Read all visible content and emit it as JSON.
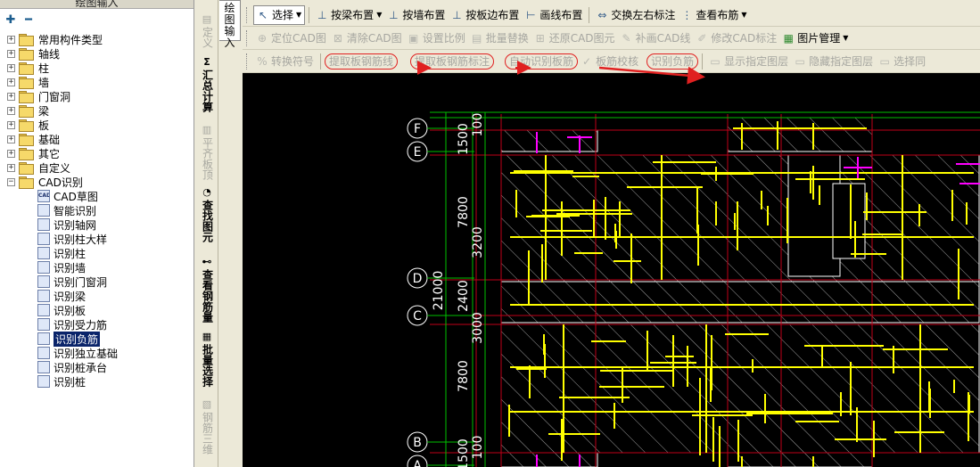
{
  "panel_title": "绘图输入",
  "tree": [
    {
      "label": "常用构件类型",
      "expanded": false
    },
    {
      "label": "轴线",
      "expanded": false
    },
    {
      "label": "柱",
      "expanded": false
    },
    {
      "label": "墙",
      "expanded": false
    },
    {
      "label": "门窗洞",
      "expanded": false
    },
    {
      "label": "梁",
      "expanded": false
    },
    {
      "label": "板",
      "expanded": false
    },
    {
      "label": "基础",
      "expanded": false
    },
    {
      "label": "其它",
      "expanded": false
    },
    {
      "label": "自定义",
      "expanded": false
    },
    {
      "label": "CAD识别",
      "expanded": true
    }
  ],
  "cad_children": [
    "CAD草图",
    "智能识别",
    "识别轴网",
    "识别柱大样",
    "识别柱",
    "识别墙",
    "识别门窗洞",
    "识别梁",
    "识别板",
    "识别受力筋",
    "识别负筋",
    "识别独立基础",
    "识别桩承台",
    "识别桩"
  ],
  "cad_icons": [
    "CAD",
    "",
    "",
    "",
    "",
    "",
    "",
    "",
    "",
    "",
    "",
    "",
    "",
    ""
  ],
  "selected_child": "识别负筋",
  "vtabs": [
    {
      "label": "定义",
      "dim": true
    },
    {
      "label": "汇总计算",
      "dim": false
    },
    {
      "label": "平齐板顶",
      "dim": true
    },
    {
      "label": "查找图元",
      "dim": false
    },
    {
      "label": "查看钢筋量",
      "dim": false
    },
    {
      "label": "批量选择",
      "dim": false
    },
    {
      "label": "钢筋三维",
      "dim": true
    }
  ],
  "vtab_active_label": "绘图输入",
  "toolbar1": {
    "select": "选择",
    "by_beam": "按梁布置",
    "by_wall": "按墙布置",
    "by_slab_edge": "按板边布置",
    "draw_line": "画线布置",
    "swap_labels": "交换左右标注",
    "view_layout": "查看布筋"
  },
  "toolbar2": {
    "locate_cad": "定位CAD图",
    "clear_cad": "清除CAD图",
    "set_scale": "设置比例",
    "batch_replace": "批量替换",
    "restore_cad": "还原CAD图元",
    "patch_cad_line": "补画CAD线",
    "modify_cad_label": "修改CAD标注",
    "image_mgmt": "图片管理"
  },
  "toolbar3": {
    "convert_symbol": "转换符号",
    "extract_rebar_line": "提取板钢筋线",
    "extract_rebar_label": "提取板钢筋标注",
    "auto_identify": "自动识别板筋",
    "rebar_check": "板筋校核",
    "identify_negative": "识别负筋",
    "show_layer": "显示指定图层",
    "hide_layer": "隐藏指定图层",
    "select_same": "选择同"
  },
  "drawing": {
    "axis_labels": [
      "F",
      "E",
      "D",
      "C",
      "B",
      "A"
    ],
    "dims_row1": [
      "1500",
      "7800",
      "2400",
      "7800",
      "1500"
    ],
    "dims_row2": [
      "100",
      "3200",
      "3000",
      "100"
    ],
    "total_dim": "21000"
  },
  "colors": {
    "accent_red": "#e02020",
    "cad_yellow": "#ffff00",
    "cad_magenta": "#ff00ff",
    "cad_red": "#c00018",
    "cad_green": "#00c000",
    "cad_white": "#ffffff"
  }
}
